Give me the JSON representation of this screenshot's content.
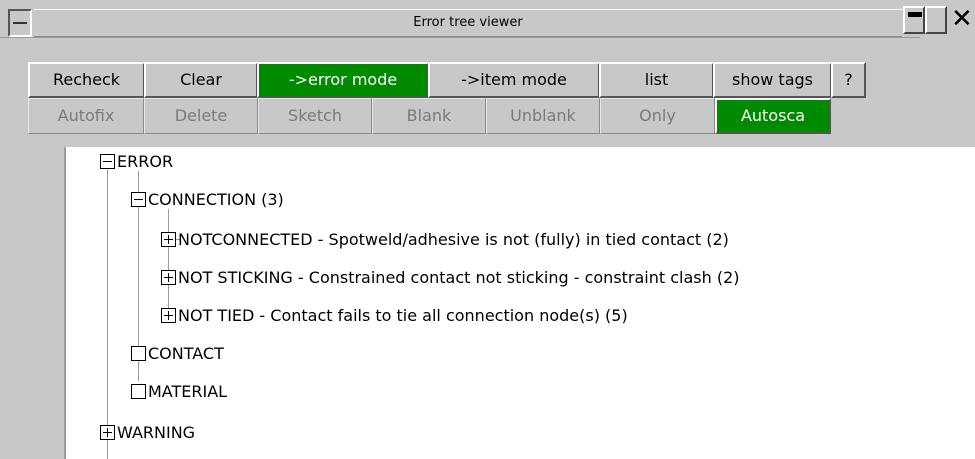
{
  "window": {
    "title": "Error tree viewer"
  },
  "toolbar_row1": {
    "recheck": "Recheck",
    "clear": "Clear",
    "error_mode": "->error mode",
    "item_mode": "->item mode",
    "list": "list",
    "show_tags": "show tags",
    "help": "?"
  },
  "toolbar_row2": {
    "autofix": "Autofix",
    "delete": "Delete",
    "sketch": "Sketch",
    "blank": "Blank",
    "unblank": "Unblank",
    "only": "Only",
    "autoscale": "Autosca"
  },
  "tree": {
    "error": {
      "label": "ERROR",
      "connection": {
        "label": "CONNECTION (3)",
        "children": [
          "NOTCONNECTED - Spotweld/adhesive is not (fully) in tied contact (2)",
          "NOT STICKING - Constrained contact not sticking - constraint clash (2)",
          "NOT TIED - Contact fails to tie all connection node(s) (5)"
        ]
      },
      "contact": "CONTACT",
      "material": "MATERIAL"
    },
    "warning": "WARNING"
  },
  "colors": {
    "active_green": "#008a00",
    "background": "#c8c8c8",
    "disabled_text": "#7a7a7a"
  }
}
